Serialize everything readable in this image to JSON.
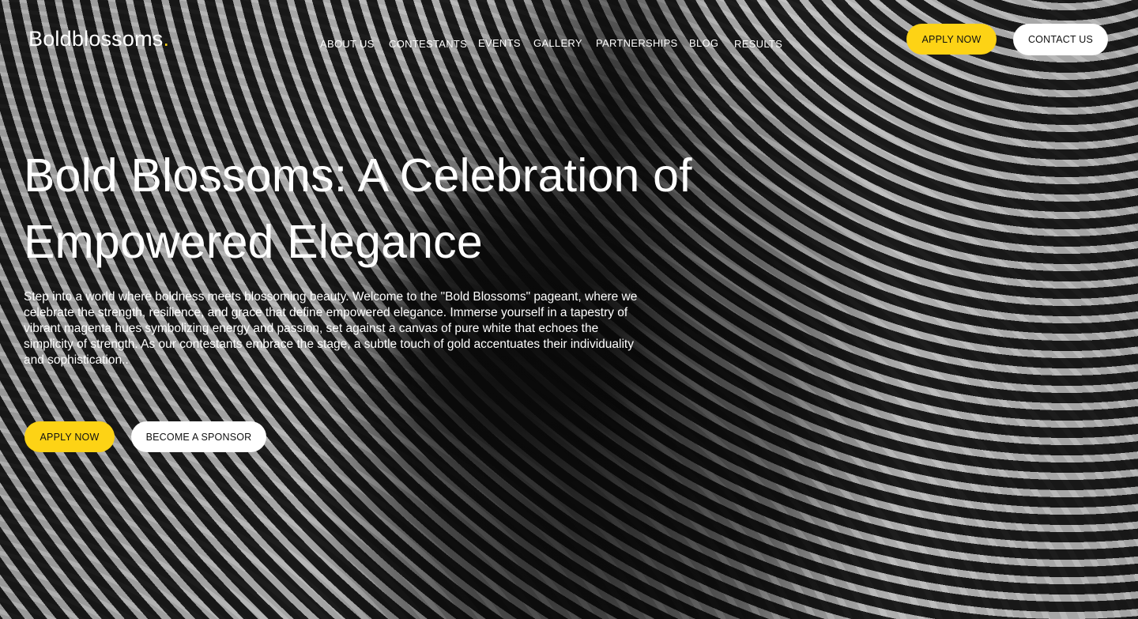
{
  "brand": {
    "name": "Boldblossoms",
    "dot": ".",
    "accent_color": "#fdd315"
  },
  "nav": {
    "items": [
      {
        "label": "ABOUT US"
      },
      {
        "label": "CONTESTANTS"
      },
      {
        "label": "EVENTS"
      },
      {
        "label": "GALLERY"
      },
      {
        "label": "PARTNERSHIPS"
      },
      {
        "label": "BLOG"
      },
      {
        "label": "RESULTS"
      }
    ],
    "apply_label": "APPLY NOW",
    "contact_label": "CONTACT US"
  },
  "hero": {
    "title_line1": "Bold Blossoms: A Celebration of",
    "title_line2": "Empowered Elegance",
    "body": "Step into a world where boldness meets blossoming beauty. Welcome to the \"Bold Blossoms\" pageant, where we celebrate the strength, resilience, and grace that define empowered elegance. Immerse yourself in a tapestry of vibrant magenta hues symbolizing energy and passion, set against a canvas of pure white that echoes the simplicity of strength. As our contestants embrace the stage, a subtle touch of gold accentuates their individuality and sophistication..",
    "apply_label": "APPLY NOW",
    "sponsor_label": "BECOME A SPONSOR"
  },
  "colors": {
    "primary_button": "#fdd315",
    "secondary_button": "#ffffff",
    "text": "#ffffff"
  }
}
